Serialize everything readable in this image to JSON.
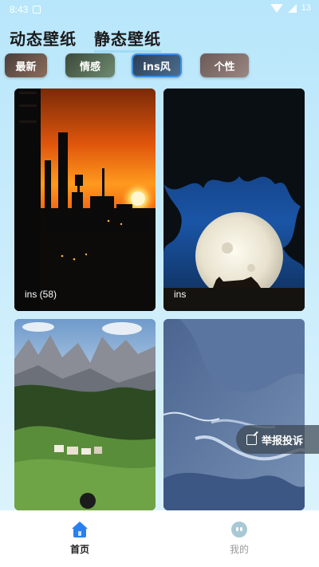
{
  "status_bar": {
    "time": "8:43",
    "battery": "13"
  },
  "header": {
    "tabs": [
      "动态壁纸",
      "静态壁纸"
    ],
    "active_tab": "静态壁纸"
  },
  "chips": [
    {
      "label": "最新"
    },
    {
      "label": "情感"
    },
    {
      "label": "ins风",
      "selected": true
    },
    {
      "label": "个性"
    }
  ],
  "cards": [
    {
      "label": "ins (58)",
      "scene": "sunset city skyline"
    },
    {
      "label": "ins",
      "scene": "moon behind tree with cat"
    },
    {
      "label": "",
      "scene": "mountain valley"
    },
    {
      "label": "",
      "scene": "aerial coastline"
    }
  ],
  "report": {
    "label": "举报投诉"
  },
  "bottom_nav": {
    "home": "首页",
    "mine": "我的"
  },
  "colors": {
    "accent": "#2a7ff0",
    "selected_border": "#3a8fe4"
  }
}
